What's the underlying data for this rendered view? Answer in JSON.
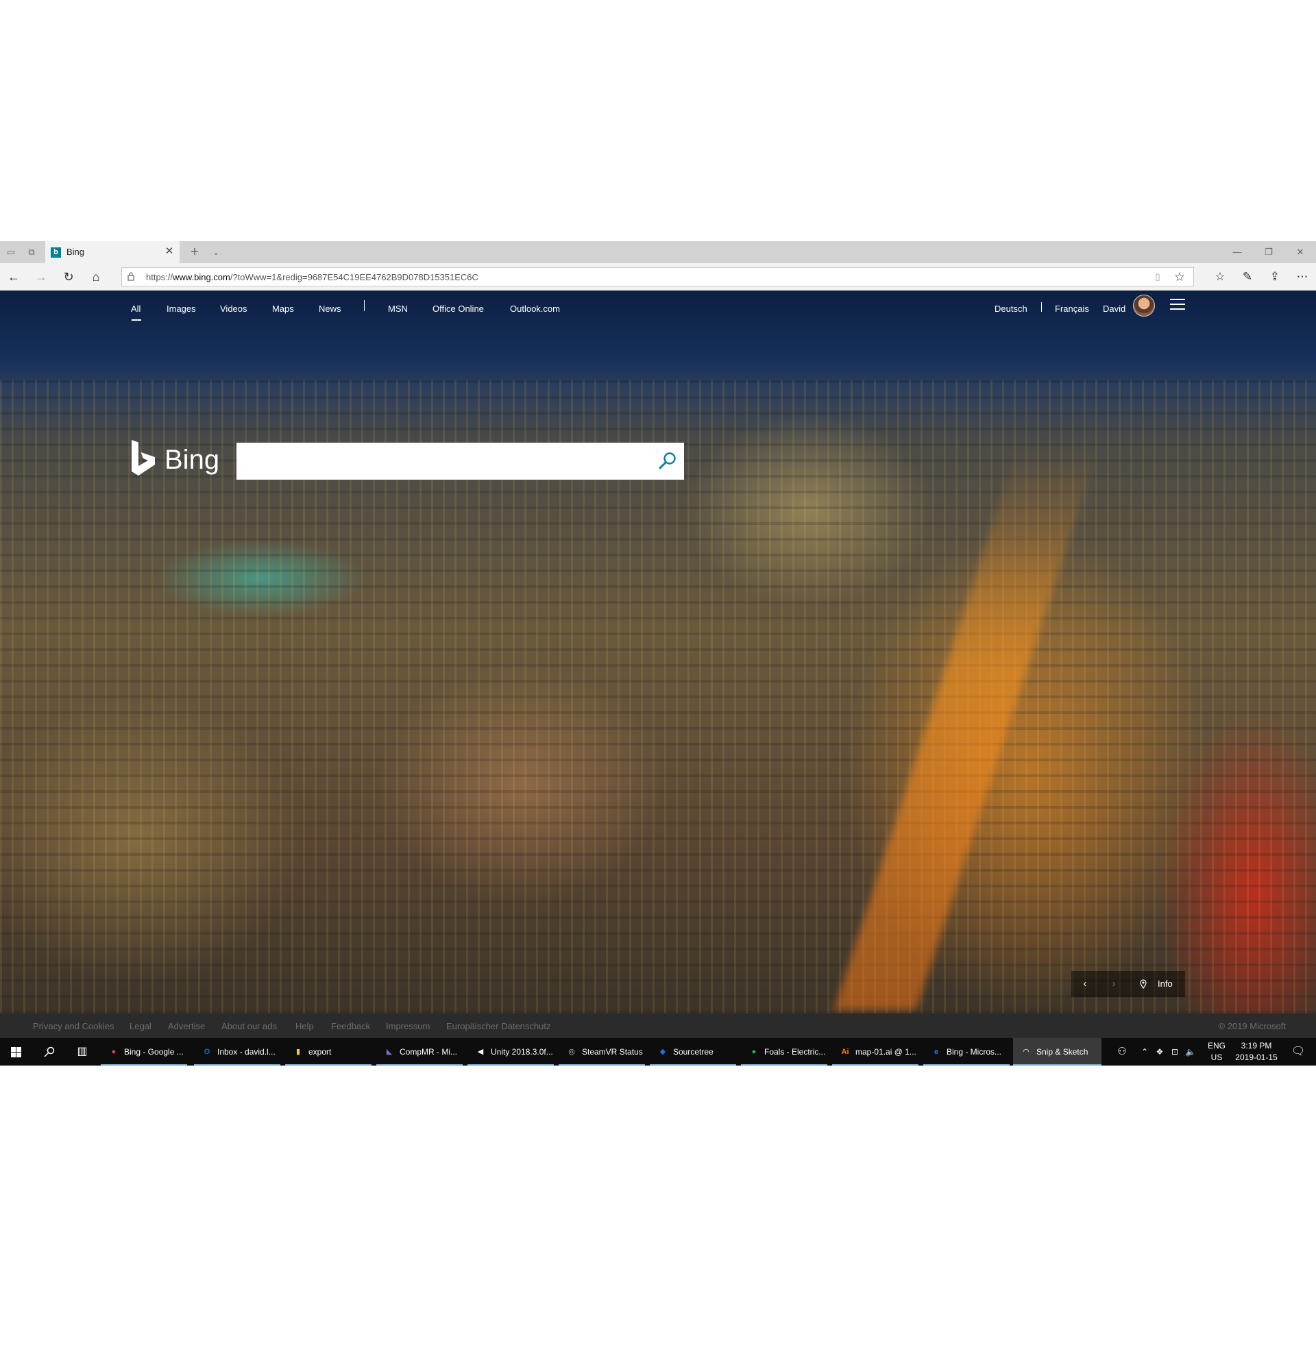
{
  "browser": {
    "tab": {
      "title": "Bing",
      "favicon": "b"
    },
    "address": {
      "url_prefix": "https://",
      "url_host": "www.bing.com",
      "url_path": "/?toWww=1&redig=9687E54C19EE4762B9D078D15351EC6C"
    }
  },
  "bing": {
    "nav": {
      "left": [
        "All",
        "Images",
        "Videos",
        "Maps",
        "News"
      ],
      "right_links": [
        "MSN",
        "Office Online",
        "Outlook.com"
      ],
      "lang1": "Deutsch",
      "lang2": "Français",
      "user": "David"
    },
    "logo_text": "Bing",
    "search": {
      "value": "",
      "placeholder": ""
    },
    "image_nav": {
      "info_label": "Info"
    },
    "footer": {
      "links": [
        "Privacy and Cookies",
        "Legal",
        "Advertise",
        "About our ads",
        "Help",
        "Feedback",
        "Impressum",
        "Europäischer Datenschutz"
      ],
      "copyright": "© 2019 Microsoft"
    }
  },
  "taskbar": {
    "items": [
      {
        "label": "Bing - Google ...",
        "icon": "chrome-icon",
        "color": "#e8453c"
      },
      {
        "label": "Inbox - david.l...",
        "icon": "outlook-icon",
        "color": "#0072c6"
      },
      {
        "label": "export",
        "icon": "folder-icon",
        "color": "#f5c84c"
      },
      {
        "label": "CompMR - Mi...",
        "icon": "visual-studio-icon",
        "color": "#8661c5"
      },
      {
        "label": "Unity 2018.3.0f...",
        "icon": "unity-icon",
        "color": "#ffffff"
      },
      {
        "label": "SteamVR Status",
        "icon": "steamvr-icon",
        "color": "#c4c4c4"
      },
      {
        "label": "Sourcetree",
        "icon": "sourcetree-icon",
        "color": "#1f6fde"
      },
      {
        "label": "Foals - Electric...",
        "icon": "spotify-icon",
        "color": "#1db954"
      },
      {
        "label": "map-01.ai @ 1...",
        "icon": "illustrator-icon",
        "color": "#ff7c00"
      },
      {
        "label": "Bing - Micros...",
        "icon": "edge-icon",
        "color": "#1f7ae0"
      },
      {
        "label": "Snip & Sketch",
        "icon": "snip-sketch-icon",
        "color": "#ffffff"
      }
    ],
    "lang_top": "ENG",
    "lang_bottom": "US",
    "time": "3:19 PM",
    "date": "2019-01-15"
  }
}
